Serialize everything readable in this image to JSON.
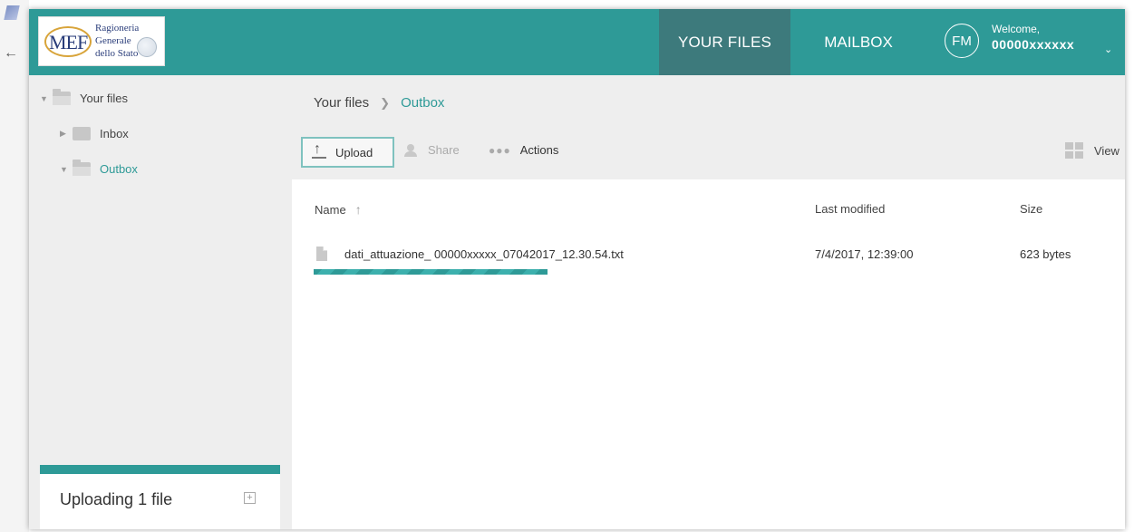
{
  "header": {
    "logo": {
      "mark": "MEF",
      "lines": [
        "Ragioneria",
        "Generale",
        "dello Stato"
      ]
    },
    "nav": {
      "your_files": "YOUR FILES",
      "mailbox": "MAILBOX"
    },
    "user": {
      "initials": "FM",
      "welcome": "Welcome,",
      "name": "00000xxxxxx"
    }
  },
  "sidebar": {
    "tree": {
      "root": "Your files",
      "items": [
        {
          "label": "Inbox",
          "expanded": false,
          "active": false
        },
        {
          "label": "Outbox",
          "expanded": true,
          "active": true
        }
      ]
    },
    "upload_status": "Uploading 1 file"
  },
  "main": {
    "breadcrumb": {
      "root": "Your files",
      "current": "Outbox"
    },
    "toolbar": {
      "upload": "Upload",
      "share": "Share",
      "actions": "Actions",
      "view": "View"
    },
    "columns": {
      "name": "Name",
      "modified": "Last modified",
      "size": "Size"
    },
    "files": [
      {
        "name": "dati_attuazione_ 00000xxxxx_07042017_12.30.54.txt",
        "modified": "7/4/2017, 12:39:00",
        "size": "623 bytes",
        "upload_progress": 1.0
      }
    ]
  },
  "colors": {
    "accent": "#2e9a97",
    "nav_active": "#3d7a7c",
    "sidebar_bg": "#eeeeee"
  },
  "icons": {
    "back": "back-arrow-icon",
    "upload": "upload-icon",
    "share": "share-icon",
    "actions": "more-dots-icon",
    "view": "grid-view-icon",
    "file": "document-icon",
    "folder": "folder-icon",
    "expand": "expand-plus-icon",
    "sort": "sort-ascending-icon",
    "user_menu": "chevron-down-icon"
  }
}
